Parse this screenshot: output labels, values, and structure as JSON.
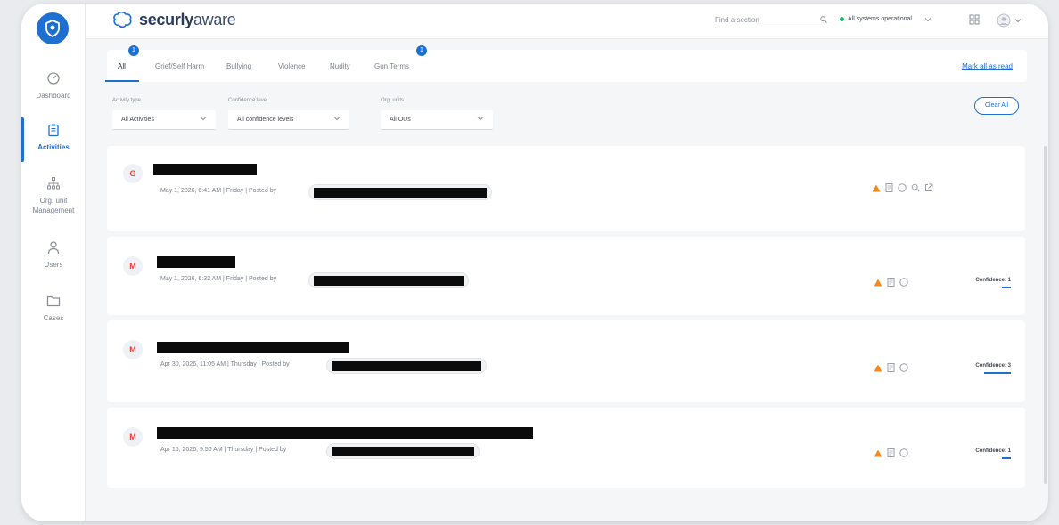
{
  "brand": {
    "name_bold": "securly",
    "name_light": "aware"
  },
  "search": {
    "placeholder": "Find a section"
  },
  "status": {
    "text": "All systems operational"
  },
  "sidebar": {
    "items": [
      {
        "label": "Dashboard",
        "icon": "dashboard-icon"
      },
      {
        "label": "Activities",
        "icon": "clipboard-icon"
      },
      {
        "label": "Org. unit Management",
        "icon": "org-chart-icon"
      },
      {
        "label": "Users",
        "icon": "user-icon"
      },
      {
        "label": "Cases",
        "icon": "folder-icon"
      }
    ]
  },
  "tabs": [
    {
      "label": "All",
      "badge": "1"
    },
    {
      "label": "Grief/Self Harm",
      "badge": ""
    },
    {
      "label": "Bullying",
      "badge": ""
    },
    {
      "label": "Violence",
      "badge": ""
    },
    {
      "label": "Nudity",
      "badge": ""
    },
    {
      "label": "Gun Terms",
      "badge": "1"
    }
  ],
  "mark_all_read": "Mark all as read",
  "filters": [
    {
      "label": "Activity type",
      "value": "All Activities"
    },
    {
      "label": "Confidence level",
      "value": "All confidence levels"
    },
    {
      "label": "Org. units",
      "value": "All OUs"
    }
  ],
  "clear_all": "Clear All",
  "activities": [
    {
      "source": "google",
      "meta": "May 1, 2026, 6:41 AM | Friday | Posted by",
      "confidence": ""
    },
    {
      "source": "gmail",
      "meta": "May 1, 2026, 6:33 AM | Friday | Posted by",
      "confidence": "Confidence: 1"
    },
    {
      "source": "gmail",
      "meta": "Apr 30, 2026, 11:05 AM | Thursday | Posted by",
      "confidence": "Confidence: 3"
    },
    {
      "source": "gmail",
      "meta": "Apr 16, 2026, 9:50 AM | Thursday | Posted by",
      "confidence": "Confidence: 1"
    }
  ],
  "colors": {
    "accent": "#1f6fd1",
    "warning": "#f08a24",
    "redaction": "#0b0b0b"
  }
}
